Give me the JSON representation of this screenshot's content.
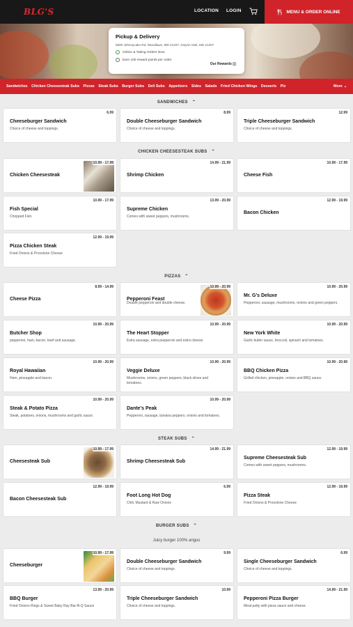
{
  "header": {
    "logo": "BLG'S",
    "location": "LOCATION",
    "login": "LOGIN",
    "order_button": "MENU & ORDER ONLINE"
  },
  "store_card": {
    "title": "Pickup & Delivery",
    "address": "5600 Johnnycake Rd, Woodlawn, MD 21207, Gwynn Oak, MD 21207",
    "status": "Online & Taking Orders Now",
    "reward": "Earn 100 reward points per order",
    "rewards_link": "Our Rewards"
  },
  "categories": [
    "Sandwiches",
    "Chicken Cheesesteak Subs",
    "Pizzas",
    "Steak Subs",
    "Burger Subs",
    "Deli Subs",
    "Appetizers",
    "Sides",
    "Salads",
    "Fried Chicken Wings",
    "Desserts",
    "Piz"
  ],
  "more_label": "More",
  "sections": {
    "sandwiches": {
      "title": "SANDWICHES",
      "items": [
        {
          "name": "Cheeseburger Sandwich",
          "price": "6.99",
          "desc": "Choice of cheese and toppings."
        },
        {
          "name": "Double Cheeseburger Sandwich",
          "price": "8.99",
          "desc": "Choice of cheese and toppings."
        },
        {
          "name": "Triple Cheeseburger Sandwich",
          "price": "12.99",
          "desc": "Choice of cheese and toppings."
        }
      ]
    },
    "chicken": {
      "title": "CHICKEN CHEESESTEAK SUBS",
      "items": [
        {
          "name": "Chicken Cheesesteak",
          "price": "10.99 - 17.99",
          "desc": ""
        },
        {
          "name": "Shrimp Chicken",
          "price": "14.99 - 21.99",
          "desc": ""
        },
        {
          "name": "Cheese Fish",
          "price": "10.99 - 17.99",
          "desc": ""
        },
        {
          "name": "Fish Special",
          "price": "10.99 - 17.99",
          "desc": "Chopped Fish."
        },
        {
          "name": "Supreme Chicken",
          "price": "13.99 - 20.99",
          "desc": "Comes with sweet peppers, mushrooms."
        },
        {
          "name": "Bacon Chicken",
          "price": "12.99 - 19.99",
          "desc": ""
        },
        {
          "name": "Pizza Chicken Steak",
          "price": "12.99 - 19.99",
          "desc": "Fried Onions & Provolone Cheese"
        }
      ]
    },
    "pizzas": {
      "title": "PIZZAS",
      "items": [
        {
          "name": "Cheese Pizza",
          "price": "8.99 - 14.99",
          "desc": ""
        },
        {
          "name": "Pepperoni Feast",
          "price": "10.99 - 20.99",
          "desc": "Double pepperoni and double cheese."
        },
        {
          "name": "Mr. G's Deluxe",
          "price": "10.99 - 20.99",
          "desc": "Pepperoni, sausage, mushrooms, onions and green peppers."
        },
        {
          "name": "Butcher Shop",
          "price": "10.99 - 20.99",
          "desc": "pepperoni, ham, bacon, beef and sausage."
        },
        {
          "name": "The Heart Stopper",
          "price": "10.99 - 20.99",
          "desc": "Extra sausage, extra pepperoni and extra cheese."
        },
        {
          "name": "New York White",
          "price": "10.99 - 20.99",
          "desc": "Garlic butter sauce, broccoli, spinach and tomatoes."
        },
        {
          "name": "Royal Hawaiian",
          "price": "10.99 - 20.99",
          "desc": "Ham, pineapple and bacon."
        },
        {
          "name": "Veggie Deluxe",
          "price": "10.99 - 20.99",
          "desc": "Mushrooms, onions, green peppers, black olives and tomatoes."
        },
        {
          "name": "BBQ Chicken Pizza",
          "price": "10.99 - 20.99",
          "desc": "Grilled chicken, pineapple, onions and BBQ sauce."
        },
        {
          "name": "Steak & Potato Pizza",
          "price": "10.99 - 20.99",
          "desc": "Steak, potatoes, onions, mushrooms and garlic sauce."
        },
        {
          "name": "Dante's Peak",
          "price": "10.99 - 20.99",
          "desc": "Pepperoni, sausage, banana peppers, onions and tomatoes."
        }
      ]
    },
    "steak": {
      "title": "STEAK SUBS",
      "items": [
        {
          "name": "Cheesesteak Sub",
          "price": "10.99 - 17.99",
          "desc": ""
        },
        {
          "name": "Shrimp Cheesesteak Sub",
          "price": "14.99 - 21.99",
          "desc": ""
        },
        {
          "name": "Supreme Cheesesteak Sub",
          "price": "12.99 - 19.99",
          "desc": "Comes with sweet peppers, mushrooms."
        },
        {
          "name": "Bacon Cheesesteak Sub",
          "price": "12.99 - 19.99",
          "desc": ""
        },
        {
          "name": "Foot Long Hot Dog",
          "price": "6.99",
          "desc": "Chili, Mustard & Raw Onions"
        },
        {
          "name": "Pizza Steak",
          "price": "12.99 - 19.99",
          "desc": "Fried Onions & Provolone Cheese"
        }
      ]
    },
    "burger": {
      "title": "BURGER SUBS",
      "description": "Juicy burger 100% angus",
      "items": [
        {
          "name": "Cheeseburger",
          "price": "10.99 - 17.99",
          "desc": ""
        },
        {
          "name": "Double Cheeseburger Sandwich",
          "price": "9.99",
          "desc": "Choice of cheese and toppings."
        },
        {
          "name": "Single Cheeseburger Sandwich",
          "price": "6.99",
          "desc": "Choice of cheese and toppings."
        },
        {
          "name": "BBQ Burger",
          "price": "13.99 - 20.99",
          "desc": "Fried Onions Rings & Sweet Baby Ray Bar-B-Q Sauce"
        },
        {
          "name": "Triple Cheeseburger Sandwich",
          "price": "10.99",
          "desc": "Choice of cheese and toppings."
        },
        {
          "name": "Pepperoni Pizza Burger",
          "price": "14.99 - 21.99",
          "desc": "Meat patty with pizza sauce and cheese."
        }
      ]
    }
  },
  "colors": {
    "brand_red": "#d0232a",
    "header_bg": "#181818",
    "page_bg": "#ececec"
  }
}
